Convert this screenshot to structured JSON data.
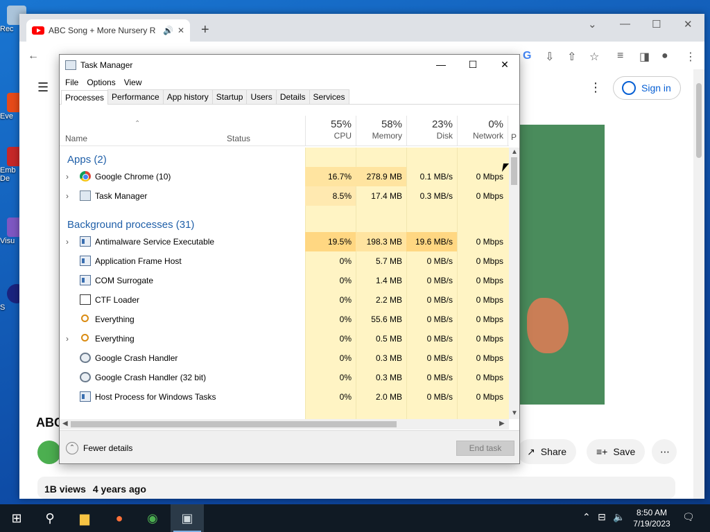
{
  "desktop": {
    "icons": [
      {
        "label": "Rec"
      },
      {
        "label": "Eve"
      },
      {
        "label": "Emb De"
      },
      {
        "label": "Visu"
      },
      {
        "label": "S"
      }
    ]
  },
  "chrome": {
    "tab_title": "ABC Song + More Nursery R",
    "signin_label": "Sign in",
    "video_title": "ABC",
    "share_label": "Share",
    "save_label": "Save",
    "views": "1B views",
    "age": "4 years ago"
  },
  "taskmanager": {
    "title": "Task Manager",
    "menu": [
      "File",
      "Options",
      "View"
    ],
    "tabs": [
      "Processes",
      "Performance",
      "App history",
      "Startup",
      "Users",
      "Details",
      "Services"
    ],
    "active_tab": "Processes",
    "columns": {
      "name": "Name",
      "status": "Status",
      "cpu": {
        "pct": "55%",
        "label": "CPU"
      },
      "memory": {
        "pct": "58%",
        "label": "Memory"
      },
      "disk": {
        "pct": "23%",
        "label": "Disk"
      },
      "network": {
        "pct": "0%",
        "label": "Network"
      },
      "power_partial": "P"
    },
    "groups": {
      "apps": "Apps (2)",
      "background": "Background processes (31)"
    },
    "rows": [
      {
        "name": "Google Chrome (10)",
        "icon": "chrome",
        "expand": true,
        "cpu": "16.7%",
        "mem": "278.9 MB",
        "disk": "0.1 MB/s",
        "net": "0 Mbps"
      },
      {
        "name": "Task Manager",
        "icon": "tm",
        "expand": true,
        "cpu": "8.5%",
        "mem": "17.4 MB",
        "disk": "0.3 MB/s",
        "net": "0 Mbps"
      },
      {
        "name": "Antimalware Service Executable",
        "icon": "svc",
        "expand": true,
        "cpu": "19.5%",
        "mem": "198.3 MB",
        "disk": "19.6 MB/s",
        "net": "0 Mbps"
      },
      {
        "name": "Application Frame Host",
        "icon": "svc",
        "expand": false,
        "cpu": "0%",
        "mem": "5.7 MB",
        "disk": "0 MB/s",
        "net": "0 Mbps"
      },
      {
        "name": "COM Surrogate",
        "icon": "svc",
        "expand": false,
        "cpu": "0%",
        "mem": "1.4 MB",
        "disk": "0 MB/s",
        "net": "0 Mbps"
      },
      {
        "name": "CTF Loader",
        "icon": "pen",
        "expand": false,
        "cpu": "0%",
        "mem": "2.2 MB",
        "disk": "0 MB/s",
        "net": "0 Mbps"
      },
      {
        "name": "Everything",
        "icon": "key",
        "expand": false,
        "cpu": "0%",
        "mem": "55.6 MB",
        "disk": "0 MB/s",
        "net": "0 Mbps"
      },
      {
        "name": "Everything",
        "icon": "key",
        "expand": true,
        "cpu": "0%",
        "mem": "0.5 MB",
        "disk": "0 MB/s",
        "net": "0 Mbps"
      },
      {
        "name": "Google Crash Handler",
        "icon": "crash",
        "expand": false,
        "cpu": "0%",
        "mem": "0.3 MB",
        "disk": "0 MB/s",
        "net": "0 Mbps"
      },
      {
        "name": "Google Crash Handler (32 bit)",
        "icon": "crash",
        "expand": false,
        "cpu": "0%",
        "mem": "0.3 MB",
        "disk": "0 MB/s",
        "net": "0 Mbps"
      },
      {
        "name": "Host Process for Windows Tasks",
        "icon": "svc",
        "expand": false,
        "cpu": "0%",
        "mem": "2.0 MB",
        "disk": "0 MB/s",
        "net": "0 Mbps"
      }
    ],
    "fewer_details": "Fewer details",
    "end_task": "End task"
  },
  "taskbar": {
    "time": "8:50 AM",
    "date": "7/19/2023"
  }
}
